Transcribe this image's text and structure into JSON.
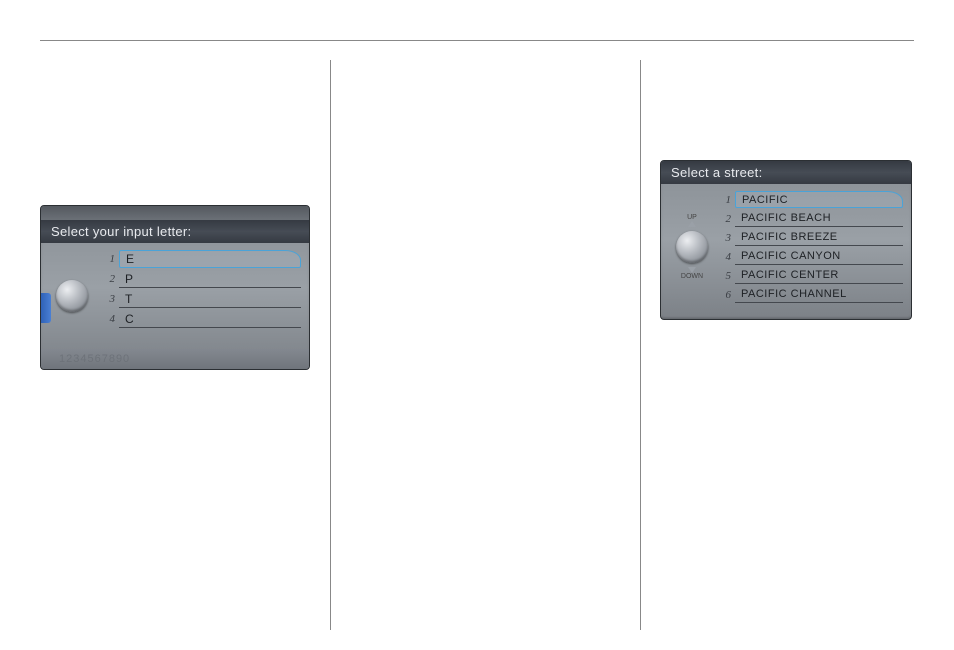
{
  "panel1": {
    "title": "Select your input letter:",
    "items": [
      {
        "num": "1",
        "label": "E",
        "selected": true
      },
      {
        "num": "2",
        "label": "P",
        "selected": false
      },
      {
        "num": "3",
        "label": "T",
        "selected": false
      },
      {
        "num": "4",
        "label": "C",
        "selected": false
      }
    ],
    "keypad": "1234567890",
    "upLabel": "",
    "downLabel": ""
  },
  "panel2": {
    "title": "Select a street:",
    "items": [
      {
        "num": "1",
        "label": "PACIFIC",
        "selected": true
      },
      {
        "num": "2",
        "label": "PACIFIC BEACH",
        "selected": false
      },
      {
        "num": "3",
        "label": "PACIFIC BREEZE",
        "selected": false
      },
      {
        "num": "4",
        "label": "PACIFIC CANYON",
        "selected": false
      },
      {
        "num": "5",
        "label": "PACIFIC CENTER",
        "selected": false
      },
      {
        "num": "6",
        "label": "PACIFIC CHANNEL",
        "selected": false
      }
    ],
    "upLabel": "UP",
    "downLabel": "DOWN"
  }
}
